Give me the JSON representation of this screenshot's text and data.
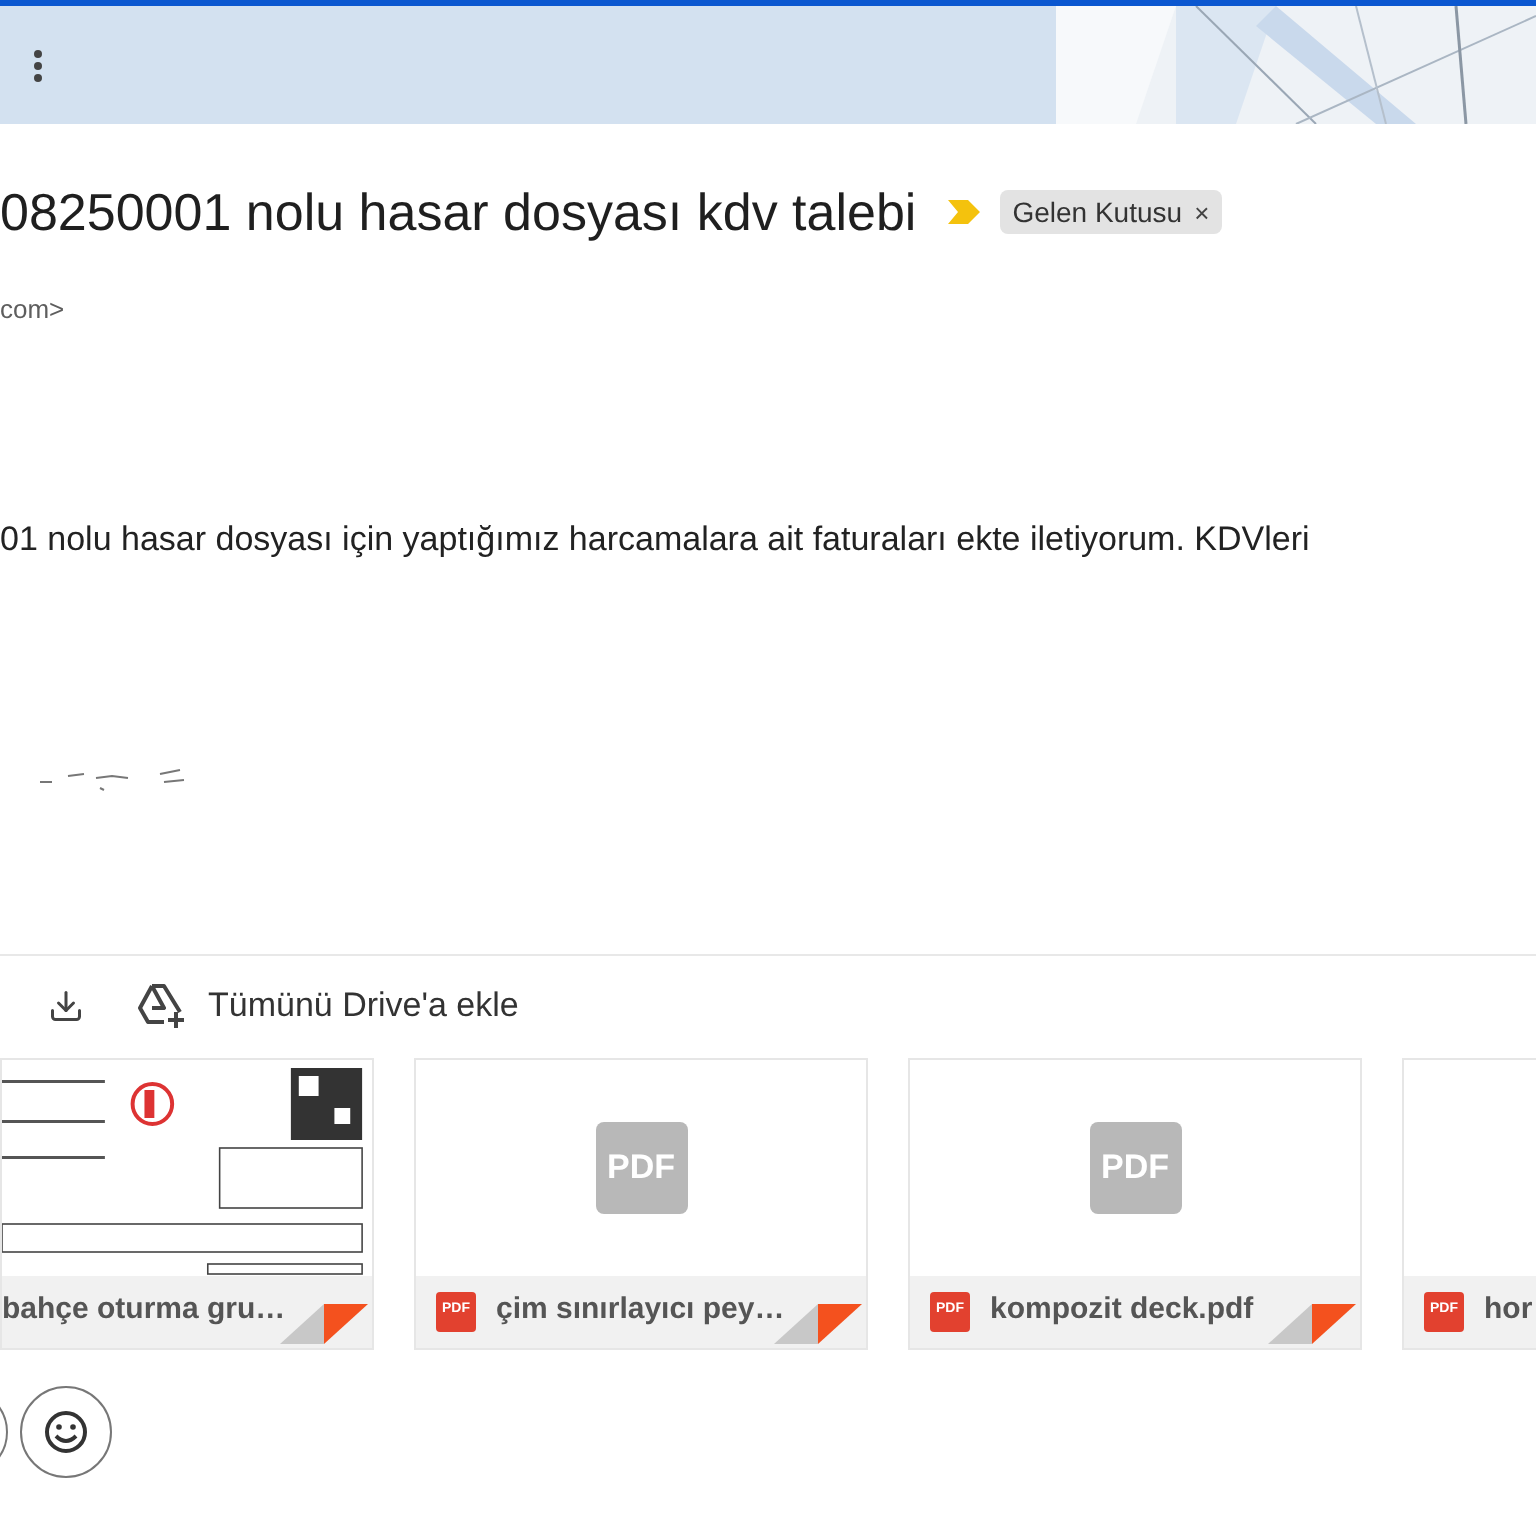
{
  "subject": {
    "title": "08250001 nolu hasar dosyası kdv talebi",
    "important": true,
    "label": "Gelen Kutusu",
    "label_close": "×"
  },
  "sender": {
    "address_tail": "com>"
  },
  "body": {
    "text": "01 nolu hasar dosyası için yaptığımız harcamalara ait faturaları ekte iletiyorum. KDVleri"
  },
  "attachments_toolbar": {
    "drive_label": "Tümünü Drive'a ekle"
  },
  "attachments": [
    {
      "kind": "preview",
      "name": "bahçe oturma gru…"
    },
    {
      "kind": "pdf",
      "name": "çim sınırlayıcı pey…",
      "badge": "PDF",
      "placeholder_label": "PDF"
    },
    {
      "kind": "pdf",
      "name": "kompozit deck.pdf",
      "badge": "PDF",
      "placeholder_label": "PDF"
    },
    {
      "kind": "pdf",
      "name": "hor",
      "badge": "PDF"
    }
  ]
}
